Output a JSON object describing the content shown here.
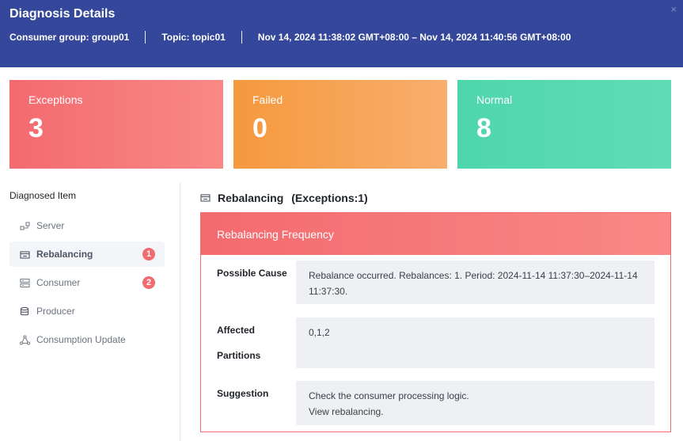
{
  "header": {
    "title": "Diagnosis Details",
    "close_glyph": "×",
    "consumer_group": "Consumer group: group01",
    "topic": "Topic:  topic01",
    "time_range": "Nov 14, 2024 11:38:02 GMT+08:00 – Nov 14, 2024 11:40:56 GMT+08:00"
  },
  "summary": {
    "exceptions": {
      "label": "Exceptions",
      "value": "3",
      "color": "#f36a6f"
    },
    "failed": {
      "label": "Failed",
      "value": "0",
      "color": "#f5993e"
    },
    "normal": {
      "label": "Normal",
      "value": "8",
      "color": "#4fd6ac"
    }
  },
  "sidebar": {
    "heading": "Diagnosed Item",
    "items": [
      {
        "label": "Server",
        "icon": "server-nodes-icon",
        "badge": ""
      },
      {
        "label": "Rebalancing",
        "icon": "rebalancing-icon",
        "badge": "1",
        "active": true
      },
      {
        "label": "Consumer",
        "icon": "consumer-icon",
        "badge": "2"
      },
      {
        "label": "Producer",
        "icon": "producer-icon",
        "badge": ""
      },
      {
        "label": "Consumption Update",
        "icon": "consumption-update-icon",
        "badge": ""
      }
    ]
  },
  "detail": {
    "section_title": "Rebalancing",
    "section_count": "(Exceptions:1)",
    "panel_title": "Rebalancing Frequency",
    "rows": [
      {
        "label": "Possible Cause",
        "lines": [
          "Rebalance occurred. Rebalances: 1. Period: 2024-11-14 11:37:30–2024-11-14 11:37:30."
        ]
      },
      {
        "label": "Affected Partitions",
        "lines": [
          "0,1,2"
        ]
      },
      {
        "label": "Suggestion",
        "lines": [
          "Check the consumer processing logic.",
          "View rebalancing."
        ]
      }
    ]
  },
  "colors": {
    "header_bg": "#34479a",
    "badge": "#f06b6f",
    "accent_red": "#f36a6f"
  }
}
